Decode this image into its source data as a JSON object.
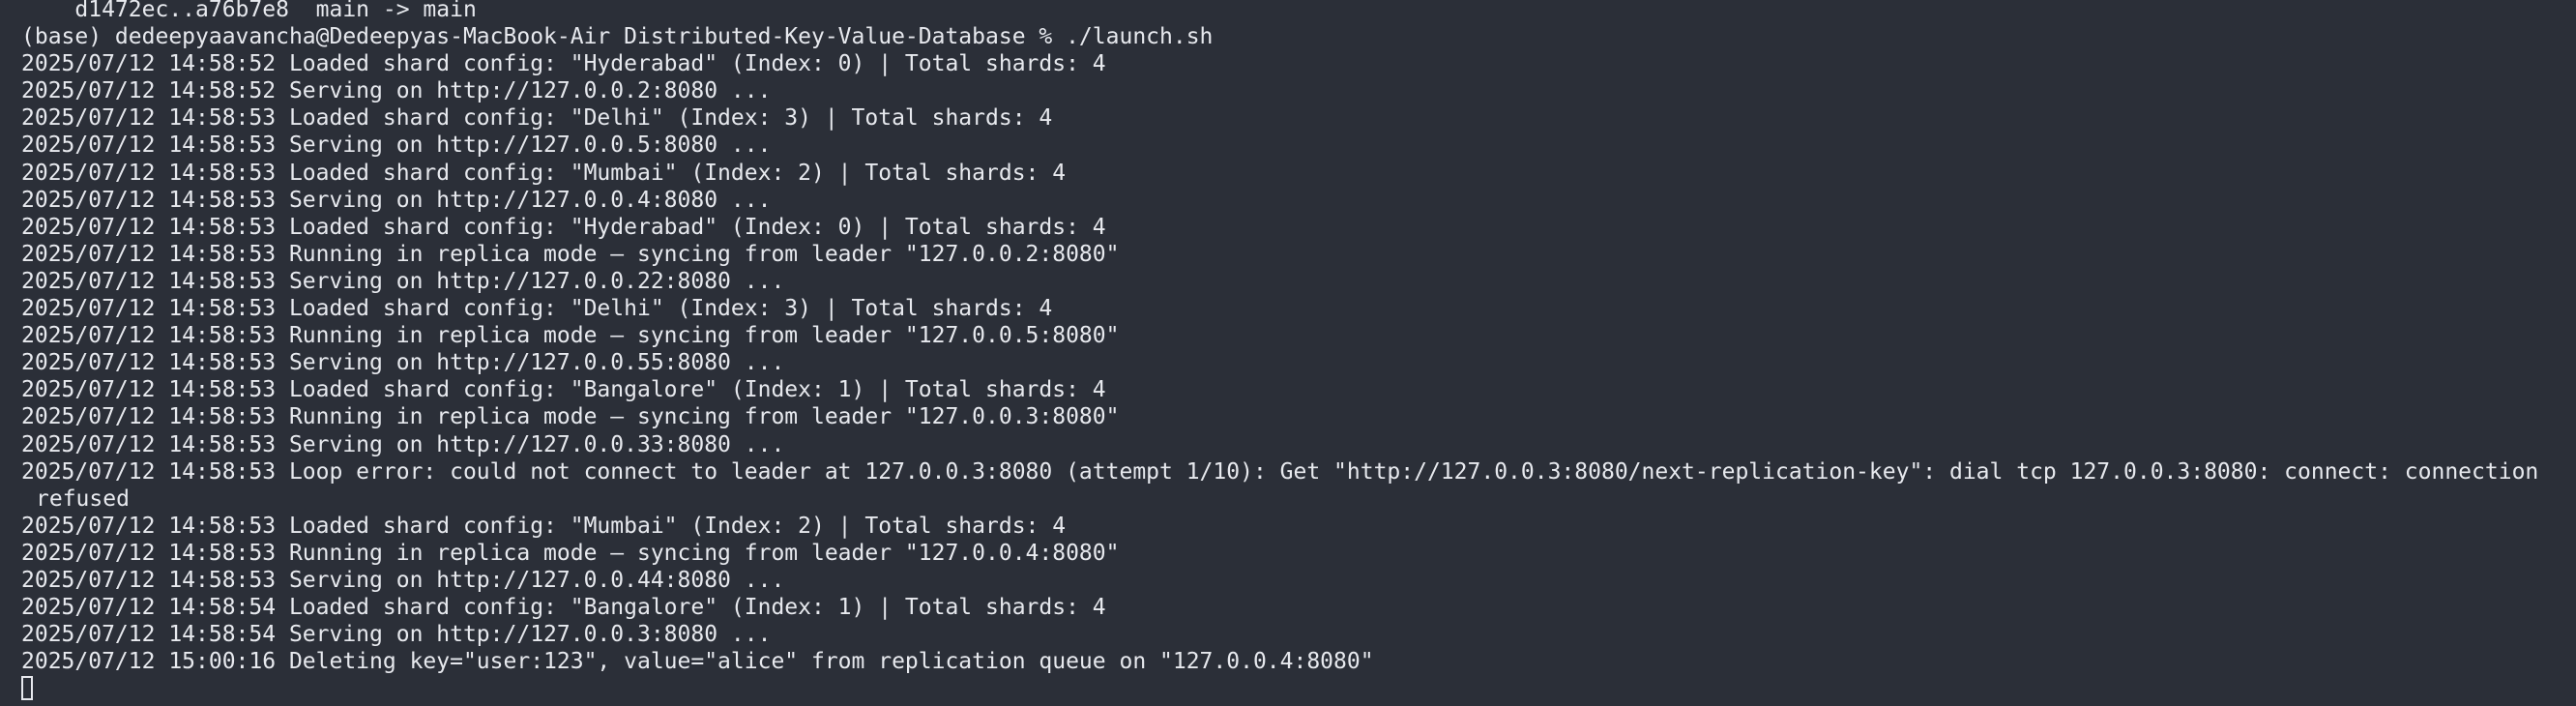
{
  "terminal": {
    "lines": [
      "    d1472ec..a76b7e8  main -> main",
      "(base) dedeepyaavancha@Dedeepyas-MacBook-Air Distributed-Key-Value-Database % ./launch.sh",
      "2025/07/12 14:58:52 Loaded shard config: \"Hyderabad\" (Index: 0) | Total shards: 4",
      "2025/07/12 14:58:52 Serving on http://127.0.0.2:8080 ...",
      "2025/07/12 14:58:53 Loaded shard config: \"Delhi\" (Index: 3) | Total shards: 4",
      "2025/07/12 14:58:53 Serving on http://127.0.0.5:8080 ...",
      "2025/07/12 14:58:53 Loaded shard config: \"Mumbai\" (Index: 2) | Total shards: 4",
      "2025/07/12 14:58:53 Serving on http://127.0.0.4:8080 ...",
      "2025/07/12 14:58:53 Loaded shard config: \"Hyderabad\" (Index: 0) | Total shards: 4",
      "2025/07/12 14:58:53 Running in replica mode – syncing from leader \"127.0.0.2:8080\"",
      "2025/07/12 14:58:53 Serving on http://127.0.0.22:8080 ...",
      "2025/07/12 14:58:53 Loaded shard config: \"Delhi\" (Index: 3) | Total shards: 4",
      "2025/07/12 14:58:53 Running in replica mode – syncing from leader \"127.0.0.5:8080\"",
      "2025/07/12 14:58:53 Serving on http://127.0.0.55:8080 ...",
      "2025/07/12 14:58:53 Loaded shard config: \"Bangalore\" (Index: 1) | Total shards: 4",
      "2025/07/12 14:58:53 Running in replica mode – syncing from leader \"127.0.0.3:8080\"",
      "2025/07/12 14:58:53 Serving on http://127.0.0.33:8080 ...",
      "2025/07/12 14:58:53 Loop error: could not connect to leader at 127.0.0.3:8080 (attempt 1/10): Get \"http://127.0.0.3:8080/next-replication-key\": dial tcp 127.0.0.3:8080: connect: connection",
      "refused",
      "2025/07/12 14:58:53 Loaded shard config: \"Mumbai\" (Index: 2) | Total shards: 4",
      "2025/07/12 14:58:53 Running in replica mode – syncing from leader \"127.0.0.4:8080\"",
      "2025/07/12 14:58:53 Serving on http://127.0.0.44:8080 ...",
      "2025/07/12 14:58:54 Loaded shard config: \"Bangalore\" (Index: 1) | Total shards: 4",
      "2025/07/12 14:58:54 Serving on http://127.0.0.3:8080 ...",
      "2025/07/12 15:00:16 Deleting key=\"user:123\", value=\"alice\" from replication queue on \"127.0.0.4:8080\""
    ]
  },
  "colors": {
    "background": "#2b2f38",
    "text": "#e7e9ee"
  }
}
